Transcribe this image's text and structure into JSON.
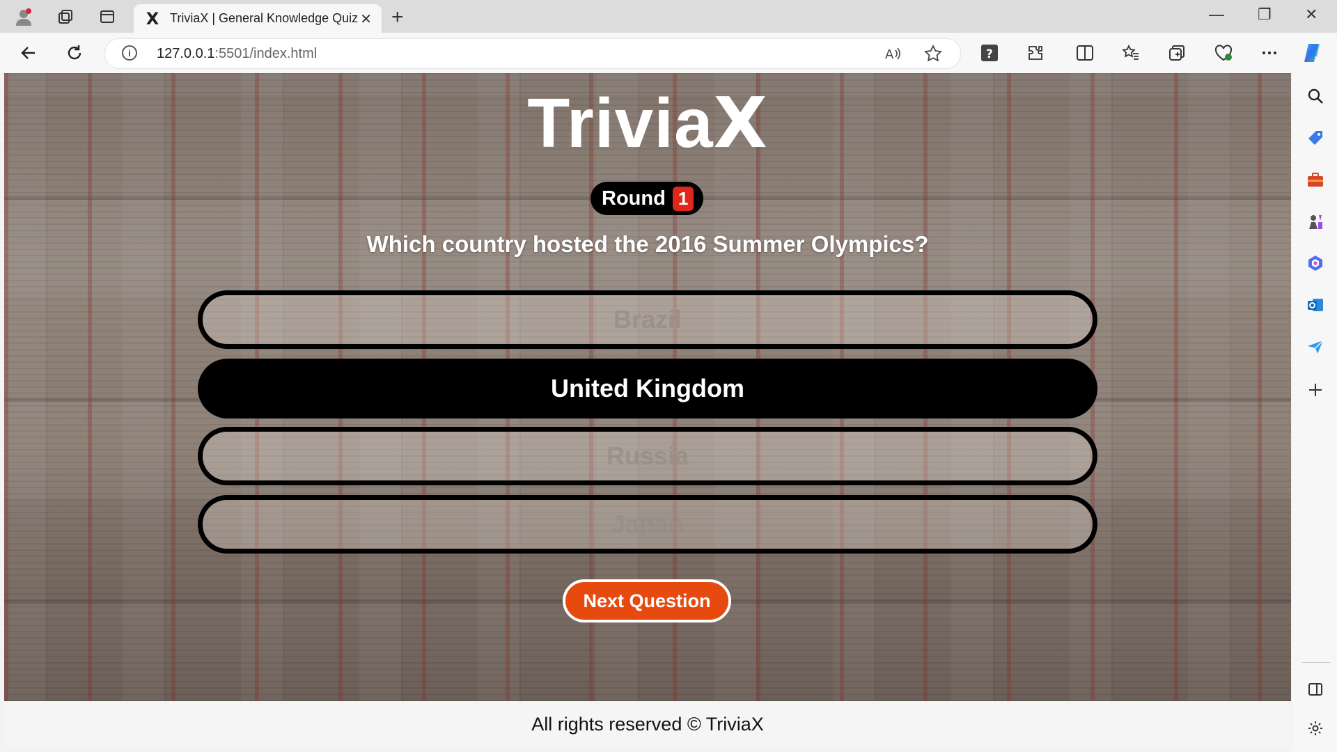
{
  "browser": {
    "tab_title": "TriviaX | General Knowledge Quiz",
    "favicon_glyph": "X",
    "tab_close": "✕",
    "new_tab": "+",
    "address_host": "127.0.0.1",
    "address_rest": ":5501/index.html",
    "window_controls": {
      "minimize": "—",
      "restore": "❐",
      "close": "✕"
    }
  },
  "page": {
    "logo_main": "Trivia",
    "logo_x": "X",
    "round_label": "Round",
    "round_number": "1",
    "question": "Which country hosted the 2016 Summer Olympics?",
    "answers": [
      "Brazil",
      "United Kingdom",
      "Russia",
      "Japan"
    ],
    "selected_answer_index": 1,
    "next_button": "Next Question",
    "footer": "All rights reserved © TriviaX"
  },
  "colors": {
    "accent_orange": "#e64a0f",
    "round_badge_red": "#e1261c",
    "answer_border": "#000000"
  },
  "icons": {
    "tabstrip": [
      "profile-icon",
      "collections-icon",
      "tab-actions-icon"
    ],
    "toolbar": [
      "back-icon",
      "refresh-icon",
      "info-icon",
      "read-aloud-icon",
      "favorite-star-icon",
      "help-icon",
      "extensions-icon",
      "split-screen-icon",
      "favorites-icon",
      "collections-icon",
      "health-icon",
      "more-icon",
      "copilot-icon"
    ],
    "sidebar": [
      "search-icon",
      "tag-icon",
      "toolbox-icon",
      "games-icon",
      "office-icon",
      "outlook-icon",
      "send-icon",
      "add-icon",
      "sidebar-toggle-icon",
      "settings-icon"
    ]
  }
}
